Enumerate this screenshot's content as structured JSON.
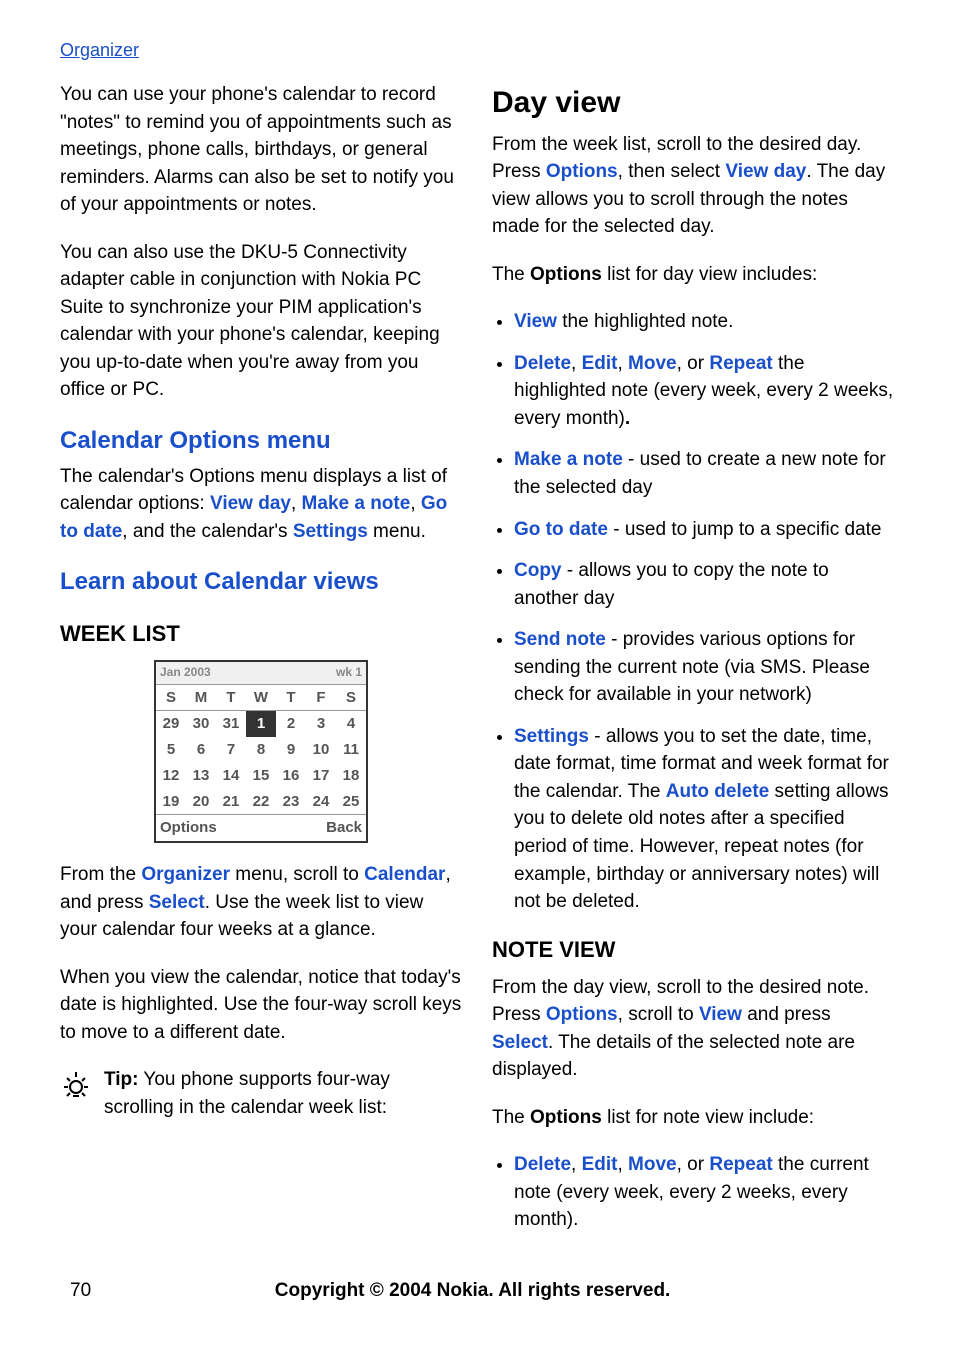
{
  "header": {
    "section": "Organizer"
  },
  "left": {
    "para1": "You can use your phone's calendar to record \"notes\" to remind you of appointments such as meetings, phone calls, birthdays, or general reminders. Alarms can also be set to notify you of your appointments or notes.",
    "para2": "You can also use the DKU-5 Connectivity adapter cable in conjunction with Nokia PC Suite to synchronize your PIM application's calendar with your phone's calendar, keeping you up-to-date when you're away from you office or PC.",
    "h_calopts": "Calendar Options menu",
    "calopts_p1_a": "The calendar's Options menu displays a list of calendar options: ",
    "calopts_viewday": "View day",
    "calopts_makenote": "Make a note",
    "calopts_gotodate": "Go to date",
    "calopts_p1_b": ", and the calendar's ",
    "calopts_settings": "Settings",
    "calopts_p1_c": " menu.",
    "h_learn": "Learn about Calendar views",
    "h_weeklist": "WEEK LIST",
    "screenshot": {
      "title": "Jan 2003",
      "week_label": "wk 1",
      "days_header": [
        "S",
        "M",
        "T",
        "W",
        "T",
        "F",
        "S"
      ],
      "rows": [
        [
          "29",
          "30",
          "31",
          "1",
          "2",
          "3",
          "4"
        ],
        [
          "5",
          "6",
          "7",
          "8",
          "9",
          "10",
          "11"
        ],
        [
          "12",
          "13",
          "14",
          "15",
          "16",
          "17",
          "18"
        ],
        [
          "19",
          "20",
          "21",
          "22",
          "23",
          "24",
          "25"
        ]
      ],
      "bottom_left": "Options",
      "bottom_right": "Back"
    },
    "weeklist_p1_a": "From the ",
    "weeklist_organizer": "Organizer",
    "weeklist_p1_b": " menu, scroll to ",
    "weeklist_calendar": "Calendar",
    "weeklist_p1_c": ", and press ",
    "weeklist_select": "Select",
    "weeklist_p1_d": ". Use the week list to view your calendar four weeks at a glance.",
    "weeklist_p2": "When you view the calendar, notice that today's date is highlighted. Use the four-way scroll keys to move to a different date.",
    "tip_label": "Tip:",
    "tip_text": " You phone supports four-way scrolling in the calendar week list:"
  },
  "right": {
    "h_dayview": "Day view",
    "dayview_p1_a": "From the week list, scroll to the desired day. Press ",
    "dayview_options1": "Options",
    "dayview_p1_b": ", then select ",
    "dayview_viewday": "View day",
    "dayview_p1_c": ". The day view allows you to scroll through the notes made for the selected day.",
    "dayview_p2_a": "The ",
    "dayview_options2": "Options",
    "dayview_p2_b": " list for day view includes:",
    "bullets": {
      "b1_view": "View",
      "b1_rest": " the highlighted note.",
      "b2_delete": "Delete",
      "b2_edit": "Edit",
      "b2_move": "Move",
      "b2_or": ", or ",
      "b2_repeat": "Repeat",
      "b2_rest": " the highlighted note (every week, every 2 weeks, every month)",
      "b3_make": "Make a note",
      "b3_rest": " - used to create a new note for the selected day",
      "b4_goto": "Go to date",
      "b4_rest": " - used to jump to a specific date",
      "b5_copy": "Copy",
      "b5_rest": " - allows you to copy the note to another day",
      "b6_send": "Send note",
      "b6_rest": " - provides various options for sending the current note (via SMS. Please check for available in your network)",
      "b7_settings": "Settings",
      "b7_mid": " - allows you to set the date, time, date format, time format and week format for the calendar. The ",
      "b7_autodel": "Auto delete",
      "b7_rest": " setting allows you to delete old notes after a specified period of time. However, repeat notes (for example, birthday or anniversary notes) will not be deleted."
    },
    "h_noteview": "NOTE VIEW",
    "noteview_p1_a": "From the day view, scroll to the desired note. Press ",
    "noteview_options": "Options",
    "noteview_p1_b": ", scroll to ",
    "noteview_view": "View",
    "noteview_p1_c": " and press ",
    "noteview_select": "Select",
    "noteview_p1_d": ". The details of the selected note are displayed.",
    "noteview_p2_a": "The ",
    "noteview_options2": "Options",
    "noteview_p2_b": " list for note view include:",
    "nb_delete": "Delete",
    "nb_edit": "Edit",
    "nb_move": "Move",
    "nb_or": ", or ",
    "nb_repeat": "Repeat",
    "nb_rest": " the current note (every week, every 2 weeks, every month)."
  },
  "footer": {
    "page": "70",
    "copyright": "Copyright © 2004 Nokia. All rights reserved."
  }
}
